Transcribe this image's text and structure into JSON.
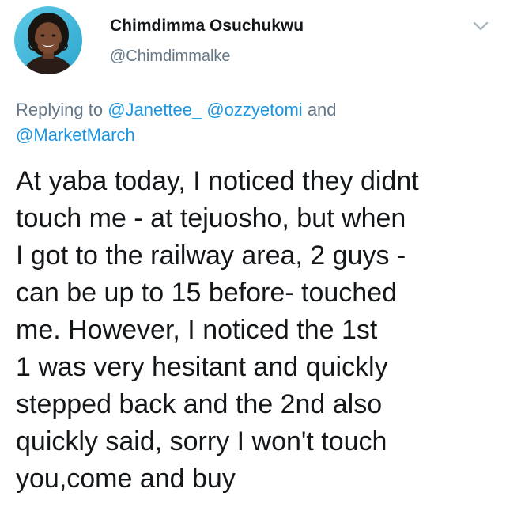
{
  "author": {
    "name": "Chimdimma Osuchukwu",
    "handle": "@Chimdimmalke"
  },
  "reply": {
    "prefix": "Replying to",
    "mentions": [
      "@Janettee_",
      "@ozzyetomi"
    ],
    "conjunction": "and",
    "last_mention": "@MarketMarch"
  },
  "tweet": {
    "text": "At yaba today, I noticed they didnt\ntouch me - at tejuosho, but when\nI got to the railway area, 2 guys -\ncan be up to 15 before- touched\nme. However, I noticed the 1st\n1 was very hesitant and quickly\nstepped back and the 2nd also\nquickly said, sorry I won't touch\nyou,come and buy"
  },
  "icons": {
    "menu": "chevron-down-icon",
    "avatar": "profile-photo"
  },
  "colors": {
    "text": "#14171a",
    "secondary": "#657786",
    "link": "#1b95e0"
  }
}
